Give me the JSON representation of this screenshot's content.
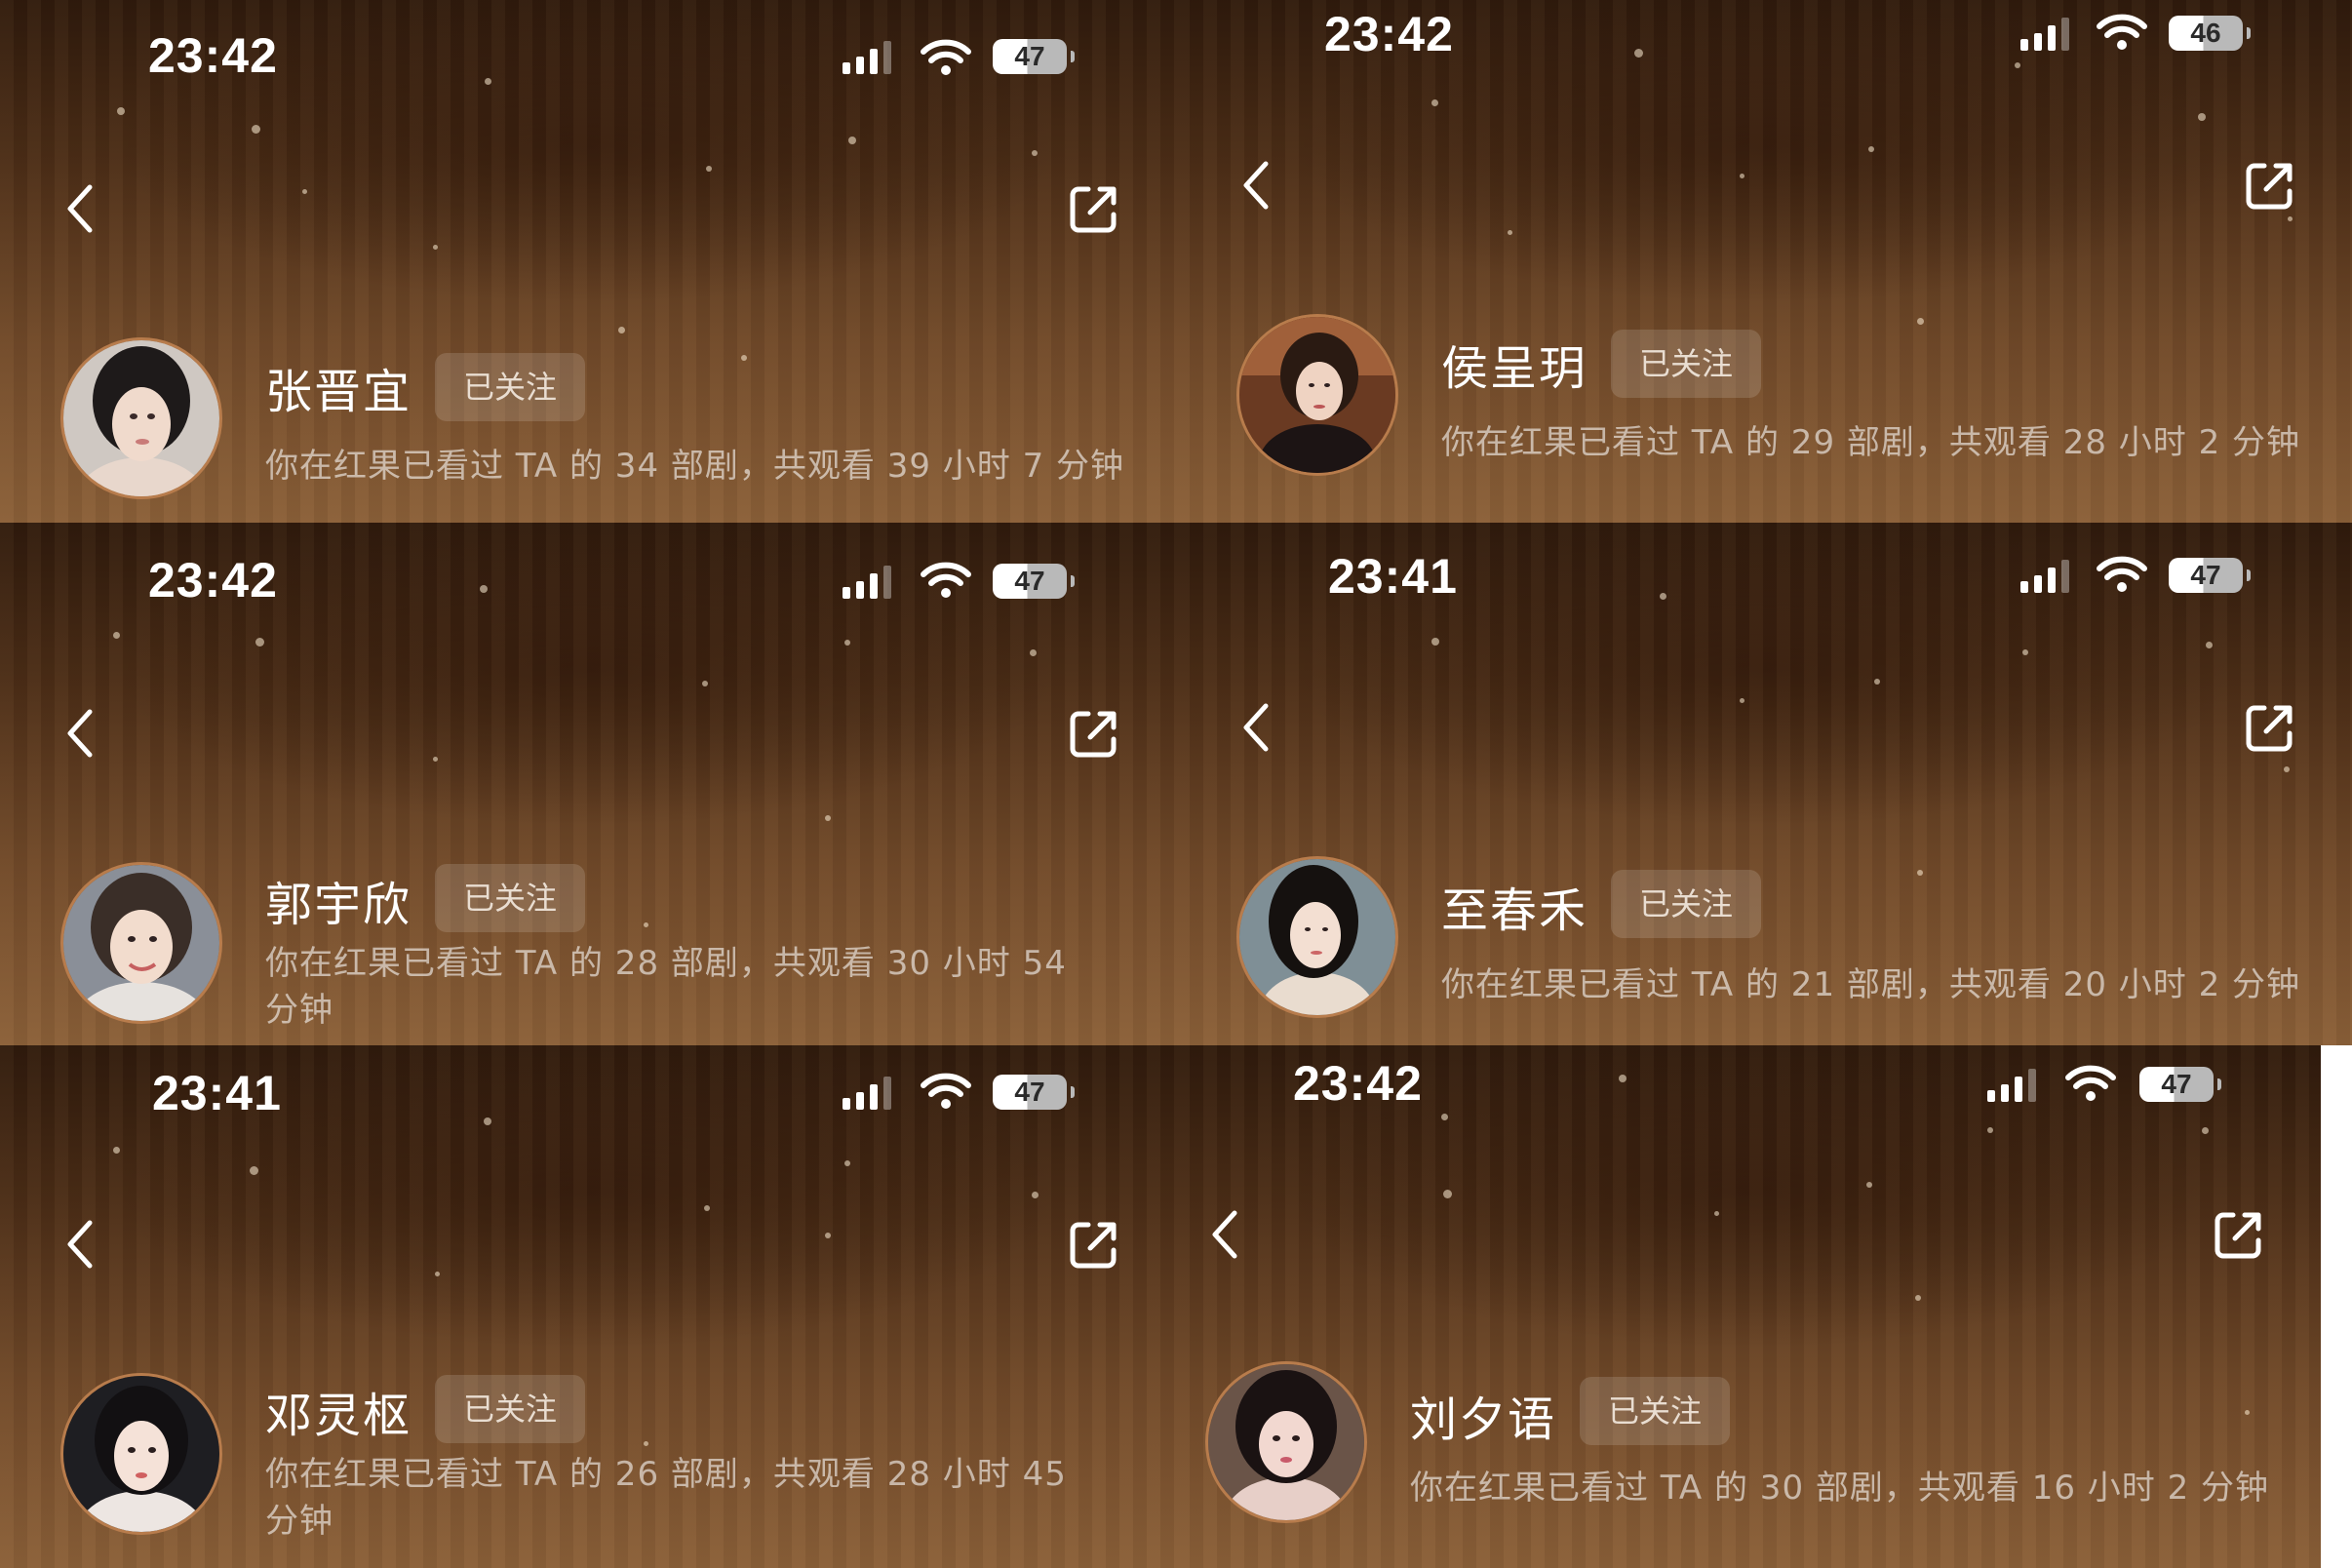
{
  "follow_label": "已关注",
  "panels": [
    {
      "time": "23:42",
      "battery": "47",
      "name": "张晋宜",
      "stats": "你在红果已看过 TA 的 34 部剧，共观看 39 小时 7 分钟"
    },
    {
      "time": "23:42",
      "battery": "46",
      "name": "侯呈玥",
      "stats": "你在红果已看过 TA 的 29 部剧，共观看 28 小时 2 分钟"
    },
    {
      "time": "23:42",
      "battery": "47",
      "name": "郭宇欣",
      "stats": "你在红果已看过 TA 的 28 部剧，共观看 30 小时 54 分钟"
    },
    {
      "time": "23:41",
      "battery": "47",
      "name": "至春禾",
      "stats": "你在红果已看过 TA 的 21 部剧，共观看 20 小时 2 分钟"
    },
    {
      "time": "23:41",
      "battery": "47",
      "name": "邓灵枢",
      "stats": "你在红果已看过 TA 的 26 部剧，共观看 28 小时 45 分钟"
    },
    {
      "time": "23:42",
      "battery": "47",
      "name": "刘夕语",
      "stats": "你在红果已看过 TA 的 30 部剧，共观看 16 小时 2 分钟"
    }
  ],
  "colors": {
    "background_top": "#2f1a0c",
    "background_bottom": "#8a5f38",
    "avatar_ring": "#b87c4c"
  },
  "icons": [
    "back-chevron-icon",
    "share-icon",
    "cellular-signal-icon",
    "wifi-icon",
    "battery-icon"
  ]
}
